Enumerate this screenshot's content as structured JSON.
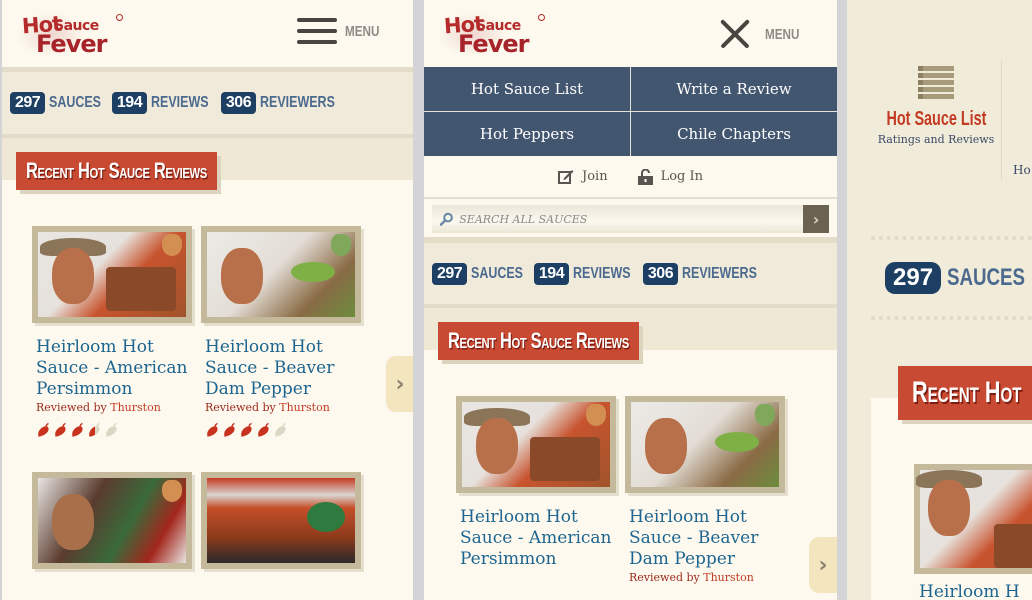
{
  "site": {
    "logo": {
      "hot": "Hot",
      "sauce": "Sauce",
      "fever": "Fever"
    },
    "menu_label": "MENU"
  },
  "stats": [
    {
      "count": "297",
      "label": "SAUCES"
    },
    {
      "count": "194",
      "label": "REVIEWS"
    },
    {
      "count": "306",
      "label": "REVIEWERS"
    }
  ],
  "section_title": "Recent Hot Sauce Reviews",
  "reviews": [
    {
      "title": "Heirloom Hot Sauce - American Persimmon",
      "by_prefix": "Reviewed by",
      "reviewer": "Thurston",
      "rating": 3.5,
      "max_rating": 5
    },
    {
      "title": "Heirloom Hot Sauce - Beaver Dam Pepper",
      "by_prefix": "Reviewed by",
      "reviewer": "Thurston",
      "rating": 4,
      "max_rating": 5
    }
  ],
  "mobile_nav": {
    "items": [
      "Hot Sauce List",
      "Write a Review",
      "Hot Peppers",
      "Chile Chapters"
    ],
    "join": "Join",
    "login": "Log In",
    "search_placeholder": "SEARCH ALL SAUCES"
  },
  "desktop_nav": {
    "item_title": "Hot Sauce List",
    "item_sub": "Ratings and Reviews",
    "next_item_partial": "Ho"
  },
  "desktop": {
    "stat_count": "297",
    "stat_label": "SAUCES",
    "section_title": "Recent Hot",
    "first_review_partial": "Heirloom H"
  },
  "colors": {
    "brand_red": "#c94a32",
    "nav_blue": "#435670",
    "stat_badge": "#1d3f63",
    "link_blue": "#1d6590",
    "chili_on": "#c8321e",
    "chili_off": "#dcd6c4"
  }
}
